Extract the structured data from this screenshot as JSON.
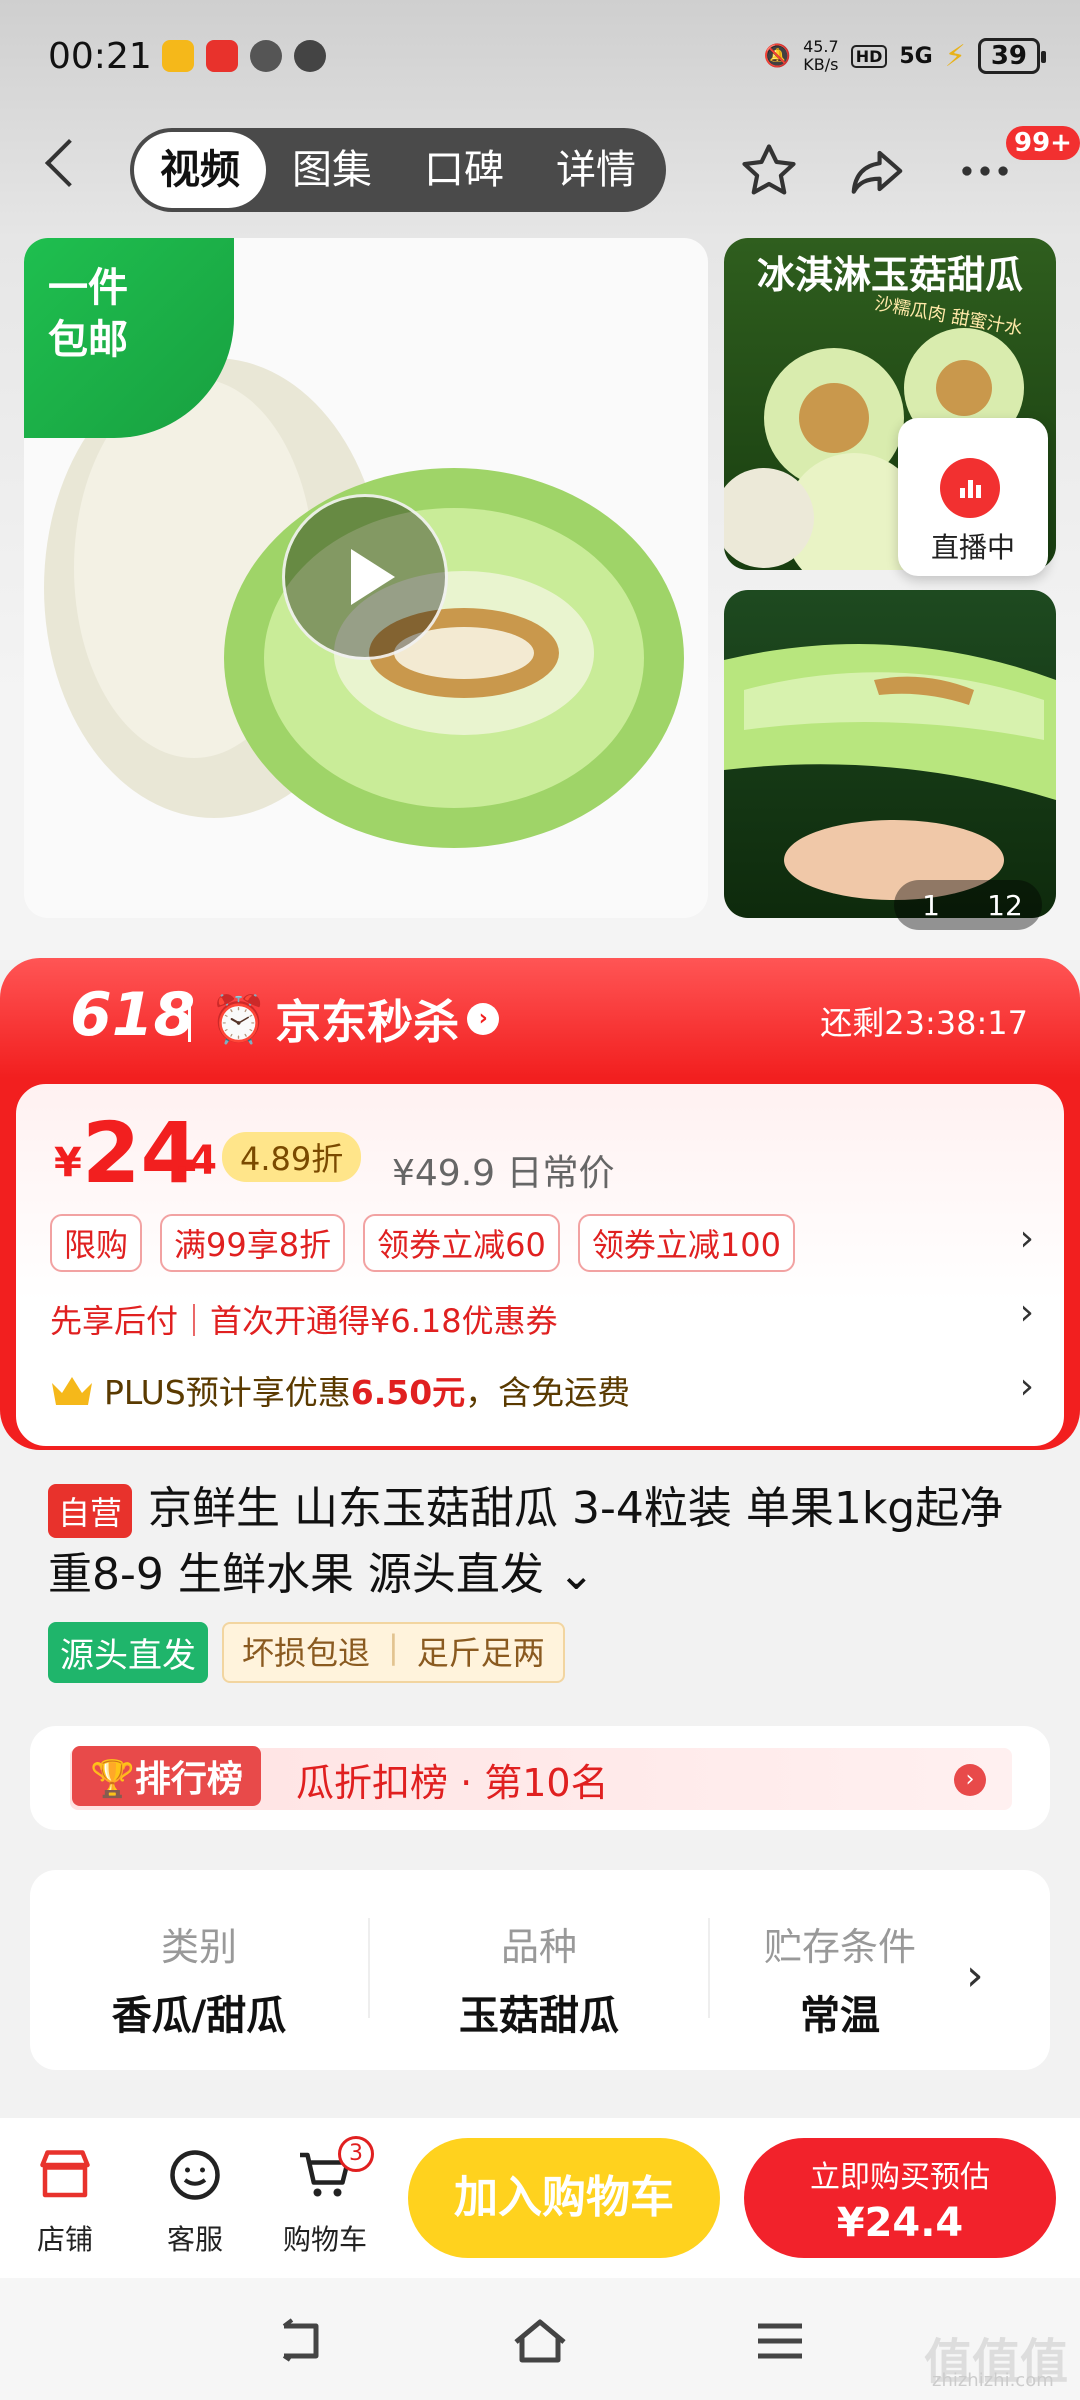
{
  "status_bar": {
    "time": "00:21",
    "net_speed": "45.7",
    "net_unit": "KB/s",
    "hd": "HD",
    "signal": "5G",
    "battery": "39"
  },
  "nav": {
    "tabs": [
      "视频",
      "图集",
      "口碑",
      "详情"
    ],
    "active_tab": 0,
    "more_badge": "99+"
  },
  "gallery": {
    "ship_tag_line1": "一件",
    "ship_tag_line2": "包邮",
    "thumb1_title": "冰淇淋玉菇甜瓜",
    "thumb1_sub": "沙糯瓜肉 甜蜜汁水",
    "live_label": "直播中",
    "pager_current": "1",
    "pager_total": "12"
  },
  "promo": {
    "event": "618",
    "brand": "京东秒杀",
    "countdown": "还剩23:38:17"
  },
  "price": {
    "currency": "¥",
    "integer": "24",
    "decimal": ".4",
    "discount": "4.89折",
    "original": "¥49.9 日常价",
    "chips": [
      "限购",
      "满99享8折",
      "领券立减60",
      "领券立减100"
    ],
    "pay_later": "先享后付｜首次开通得¥6.18优惠券",
    "plus_prefix": "PLUS预计享优惠",
    "plus_amount": "6.50元",
    "plus_suffix": "，含免运费"
  },
  "product": {
    "badge": "自营",
    "title": "京鲜生 山东玉菇甜瓜 3-4粒装 单果1kg起净重8-9 生鲜水果 源头直发",
    "tag_green": "源头直发",
    "tag_yellow": [
      "坏损包退",
      "足斤足两"
    ]
  },
  "rank": {
    "label": "排行榜",
    "text": "瓜折扣榜 · 第10名"
  },
  "attributes": [
    {
      "k": "类别",
      "v": "香瓜/甜瓜"
    },
    {
      "k": "品种",
      "v": "玉菇甜瓜"
    },
    {
      "k": "贮存条件",
      "v": "常温"
    }
  ],
  "bottom_bar": {
    "store": "店铺",
    "service": "客服",
    "cart": "购物车",
    "cart_count": "3",
    "add_cart": "加入购物车",
    "buy_line1": "立即购买预估",
    "buy_line2": "¥24.4"
  },
  "watermark": {
    "text": "值值值",
    "url": "zhizhizhi.com"
  },
  "colors": {
    "accent_red": "#f21f1f",
    "yellow_button": "#ffd21e",
    "green_tag": "#1fb56b"
  }
}
